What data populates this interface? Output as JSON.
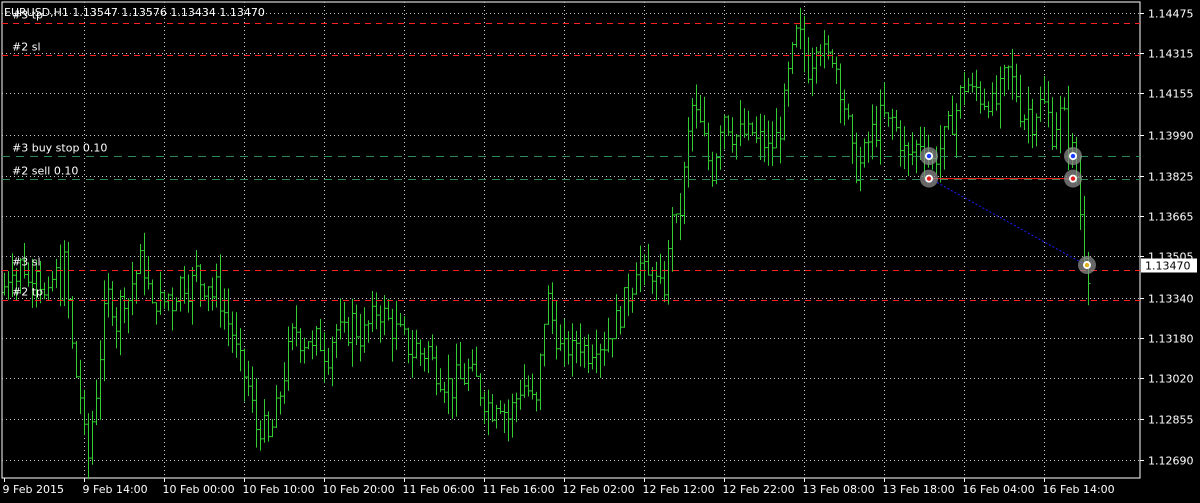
{
  "window": {
    "header": "EURUSD,H1  1.13547 1.13576 1.13434 1.13470"
  },
  "colors": {
    "background": "#000000",
    "grid": "#c8c8c8",
    "bar": "#33cc33",
    "axis": "#ffffff",
    "sl_tp_line": "#ff2020",
    "pending_line": "#2e8b57",
    "position_line": "#ff2020",
    "trade_arrow": "#1c1cff",
    "marker_ring": "#8a8a8a"
  },
  "chart_data": {
    "type": "bar",
    "symbol": "EURUSD",
    "timeframe": "H1",
    "last_price": "1.13470",
    "y_axis": {
      "range": [
        1.1262,
        1.1452
      ],
      "ticks": [
        "1.14475",
        "1.14315",
        "1.14155",
        "1.13990",
        "1.13825",
        "1.13665",
        "1.13505",
        "1.13340",
        "1.13180",
        "1.13020",
        "1.12855",
        "1.12690"
      ]
    },
    "x_axis": {
      "ticks": [
        "9 Feb 2015",
        "9 Feb 14:00",
        "10 Feb 00:00",
        "10 Feb 10:00",
        "10 Feb 20:00",
        "11 Feb 06:00",
        "11 Feb 16:00",
        "12 Feb 02:00",
        "12 Feb 12:00",
        "12 Feb 22:00",
        "13 Feb 08:00",
        "13 Feb 18:00",
        "16 Feb 04:00",
        "16 Feb 14:00"
      ]
    },
    "grid": true,
    "ohlc_path": [
      [
        0,
        1.1336
      ],
      [
        5,
        1.1342
      ],
      [
        10,
        1.1348
      ],
      [
        15,
        1.134
      ],
      [
        20,
        1.1352
      ],
      [
        25,
        1.1338
      ],
      [
        30,
        1.1345
      ],
      [
        35,
        1.135
      ],
      [
        40,
        1.1335
      ],
      [
        45,
        1.133
      ],
      [
        52,
        1.1345
      ],
      [
        58,
        1.1338
      ],
      [
        63,
        1.135
      ],
      [
        68,
        1.132
      ],
      [
        73,
        1.1305
      ],
      [
        78,
        1.1295
      ],
      [
        82,
        1.1278
      ],
      [
        86,
        1.127
      ],
      [
        90,
        1.1285
      ],
      [
        95,
        1.13
      ],
      [
        100,
        1.132
      ],
      [
        105,
        1.1335
      ],
      [
        110,
        1.1332
      ],
      [
        115,
        1.1322
      ],
      [
        120,
        1.1338
      ],
      [
        125,
        1.1332
      ],
      [
        130,
        1.134
      ],
      [
        135,
        1.1345
      ],
      [
        140,
        1.135
      ],
      [
        145,
        1.134
      ],
      [
        150,
        1.1328
      ],
      [
        155,
        1.1335
      ],
      [
        160,
        1.133
      ],
      [
        165,
        1.1336
      ],
      [
        170,
        1.1332
      ],
      [
        175,
        1.1338
      ],
      [
        180,
        1.1342
      ],
      [
        185,
        1.1338
      ],
      [
        190,
        1.134
      ],
      [
        195,
        1.1345
      ],
      [
        200,
        1.1338
      ],
      [
        205,
        1.1342
      ],
      [
        210,
        1.1335
      ],
      [
        215,
        1.1338
      ],
      [
        220,
        1.133
      ],
      [
        225,
        1.1325
      ],
      [
        230,
        1.132
      ],
      [
        235,
        1.131
      ],
      [
        240,
        1.1305
      ],
      [
        245,
        1.13
      ],
      [
        250,
        1.129
      ],
      [
        255,
        1.128
      ],
      [
        260,
        1.1285
      ],
      [
        265,
        1.1275
      ],
      [
        270,
        1.1282
      ],
      [
        275,
        1.129
      ],
      [
        280,
        1.13
      ],
      [
        285,
        1.131
      ],
      [
        290,
        1.1318
      ],
      [
        295,
        1.1322
      ],
      [
        300,
        1.1315
      ],
      [
        305,
        1.132
      ],
      [
        310,
        1.1312
      ],
      [
        315,
        1.1318
      ],
      [
        320,
        1.1315
      ],
      [
        325,
        1.131
      ],
      [
        330,
        1.1318
      ],
      [
        335,
        1.1322
      ],
      [
        340,
        1.1318
      ],
      [
        345,
        1.132
      ],
      [
        350,
        1.1325
      ],
      [
        355,
        1.132
      ],
      [
        360,
        1.1318
      ],
      [
        365,
        1.1322
      ],
      [
        370,
        1.1325
      ],
      [
        375,
        1.133
      ],
      [
        380,
        1.1328
      ],
      [
        385,
        1.1325
      ],
      [
        390,
        1.1322
      ],
      [
        395,
        1.132
      ],
      [
        400,
        1.1318
      ],
      [
        405,
        1.1315
      ],
      [
        410,
        1.1312
      ],
      [
        415,
        1.1315
      ],
      [
        420,
        1.131
      ],
      [
        425,
        1.1315
      ],
      [
        430,
        1.1308
      ],
      [
        435,
        1.1305
      ],
      [
        440,
        1.1302
      ],
      [
        445,
        1.13
      ],
      [
        450,
        1.1298
      ],
      [
        455,
        1.1302
      ],
      [
        460,
        1.13
      ],
      [
        465,
        1.1305
      ],
      [
        470,
        1.1302
      ],
      [
        475,
        1.13
      ],
      [
        480,
        1.1295
      ],
      [
        485,
        1.1292
      ],
      [
        490,
        1.129
      ],
      [
        495,
        1.1295
      ],
      [
        500,
        1.1292
      ],
      [
        505,
        1.1285
      ],
      [
        510,
        1.129
      ],
      [
        515,
        1.1295
      ],
      [
        520,
        1.13
      ],
      [
        525,
        1.1298
      ],
      [
        530,
        1.1292
      ],
      [
        535,
        1.129
      ],
      [
        540,
        1.132
      ],
      [
        545,
        1.1335
      ],
      [
        550,
        1.1325
      ],
      [
        555,
        1.1318
      ],
      [
        560,
        1.131
      ],
      [
        565,
        1.1315
      ],
      [
        570,
        1.1312
      ],
      [
        575,
        1.1318
      ],
      [
        580,
        1.1315
      ],
      [
        585,
        1.1312
      ],
      [
        590,
        1.1315
      ],
      [
        595,
        1.1318
      ],
      [
        600,
        1.1315
      ],
      [
        605,
        1.1318
      ],
      [
        610,
        1.1322
      ],
      [
        615,
        1.1325
      ],
      [
        620,
        1.133
      ],
      [
        625,
        1.1335
      ],
      [
        630,
        1.134
      ],
      [
        635,
        1.135
      ],
      [
        640,
        1.1345
      ],
      [
        645,
        1.134
      ],
      [
        650,
        1.1345
      ],
      [
        655,
        1.1338
      ],
      [
        660,
        1.1335
      ],
      [
        665,
        1.1345
      ],
      [
        670,
        1.137
      ],
      [
        675,
        1.136
      ],
      [
        680,
        1.1375
      ],
      [
        685,
        1.1395
      ],
      [
        690,
        1.141
      ],
      [
        695,
        1.1405
      ],
      [
        700,
        1.14
      ],
      [
        705,
        1.139
      ],
      [
        710,
        1.1385
      ],
      [
        715,
        1.1395
      ],
      [
        720,
        1.141
      ],
      [
        725,
        1.1405
      ],
      [
        730,
        1.14
      ],
      [
        735,
        1.1398
      ],
      [
        740,
        1.14
      ],
      [
        745,
        1.1398
      ],
      [
        750,
        1.14
      ],
      [
        755,
        1.1395
      ],
      [
        760,
        1.1398
      ],
      [
        765,
        1.1392
      ],
      [
        770,
        1.1395
      ],
      [
        775,
        1.1398
      ],
      [
        780,
        1.1405
      ],
      [
        785,
        1.142
      ],
      [
        790,
        1.143
      ],
      [
        795,
        1.144
      ],
      [
        800,
        1.1435
      ],
      [
        805,
        1.1425
      ],
      [
        810,
        1.143
      ],
      [
        815,
        1.144
      ],
      [
        820,
        1.1432
      ],
      [
        825,
        1.1428
      ],
      [
        830,
        1.1432
      ],
      [
        835,
        1.1425
      ],
      [
        840,
        1.1415
      ],
      [
        845,
        1.1405
      ],
      [
        850,
        1.139
      ],
      [
        855,
        1.1385
      ],
      [
        860,
        1.1388
      ],
      [
        865,
        1.1395
      ],
      [
        870,
        1.14
      ],
      [
        875,
        1.1402
      ],
      [
        880,
        1.1408
      ],
      [
        885,
        1.1402
      ],
      [
        890,
        1.1405
      ],
      [
        895,
        1.14
      ],
      [
        900,
        1.1395
      ],
      [
        905,
        1.1388
      ],
      [
        910,
        1.1392
      ],
      [
        915,
        1.1395
      ],
      [
        920,
        1.1398
      ],
      [
        925,
        1.1392
      ],
      [
        930,
        1.1388
      ],
      [
        935,
        1.1392
      ],
      [
        940,
        1.1395
      ],
      [
        945,
        1.14
      ],
      [
        950,
        1.1405
      ],
      [
        955,
        1.141
      ],
      [
        960,
        1.1418
      ],
      [
        965,
        1.142
      ],
      [
        970,
        1.1415
      ],
      [
        975,
        1.1418
      ],
      [
        980,
        1.1412
      ],
      [
        985,
        1.1415
      ],
      [
        990,
        1.141
      ],
      [
        995,
        1.1412
      ],
      [
        1000,
        1.1418
      ],
      [
        1005,
        1.1425
      ],
      [
        1010,
        1.142
      ],
      [
        1015,
        1.1415
      ],
      [
        1020,
        1.1405
      ],
      [
        1025,
        1.141
      ],
      [
        1030,
        1.1405
      ],
      [
        1035,
        1.141
      ],
      [
        1040,
        1.1412
      ],
      [
        1045,
        1.1408
      ],
      [
        1050,
        1.14
      ],
      [
        1055,
        1.1405
      ],
      [
        1060,
        1.1408
      ],
      [
        1065,
        1.14
      ],
      [
        1070,
        1.1392
      ],
      [
        1075,
        1.138
      ],
      [
        1080,
        1.136
      ],
      [
        1085,
        1.1345
      ],
      [
        1090,
        1.1347
      ]
    ],
    "horizontal_lines": [
      {
        "label": "#3 tp",
        "price": 1.14435,
        "kind": "tp"
      },
      {
        "label": "#2 sl",
        "price": 1.1431,
        "kind": "sl"
      },
      {
        "label": "#3 buy stop 0.10",
        "price": 1.13905,
        "kind": "pending"
      },
      {
        "label": "#2 sell 0.10",
        "price": 1.13815,
        "kind": "pending"
      },
      {
        "label": "#3 sl",
        "price": 1.1345,
        "kind": "sl"
      },
      {
        "label": "#2 tp",
        "price": 1.1333,
        "kind": "tp"
      }
    ]
  }
}
